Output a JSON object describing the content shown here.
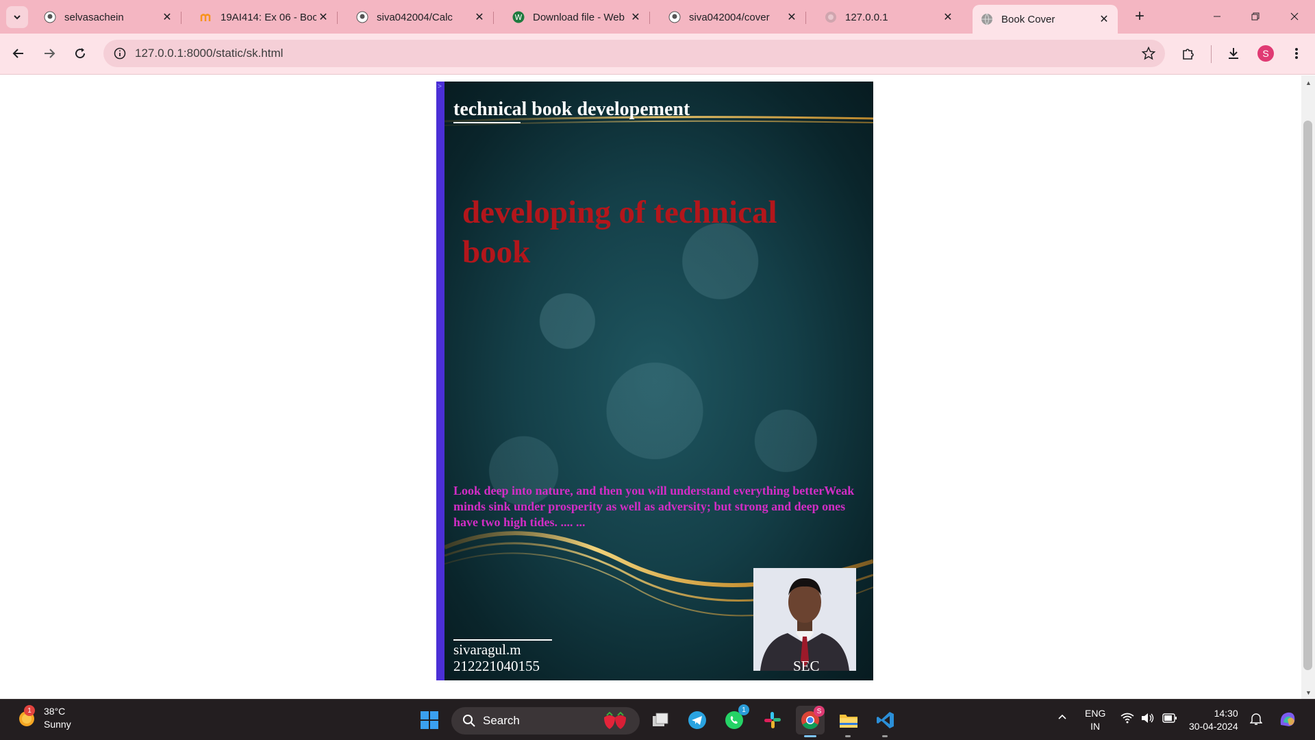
{
  "browser": {
    "tabs": [
      {
        "title": "selvasachein",
        "icon": "github-icon"
      },
      {
        "title": "19AI414: Ex 06 - Boo",
        "icon": "moodle-icon"
      },
      {
        "title": "siva042004/Calc",
        "icon": "github-icon"
      },
      {
        "title": "Download file - Web",
        "icon": "web-icon"
      },
      {
        "title": "siva042004/cover",
        "icon": "github-icon"
      },
      {
        "title": "127.0.0.1",
        "icon": "globe-icon"
      },
      {
        "title": "Book Cover",
        "icon": "globe-icon",
        "active": true
      }
    ],
    "url": "127.0.0.1:8000/static/sk.html",
    "profile_initial": "S"
  },
  "cover": {
    "spine_mark": ">",
    "header": "technical book developement",
    "title": "developing of technical book",
    "quote": "Look deep into nature, and then you will understand everything betterWeak minds sink under prosperity as well as adversity; but strong and deep ones have two high tides. .... ...",
    "author_name": "sivaragul.m",
    "author_id": "212221040155",
    "college": "SEC",
    "colors": {
      "spine": "#4b2fd6",
      "title": "#b3161b",
      "quote": "#d22dc5",
      "header": "#ffffff"
    }
  },
  "taskbar": {
    "weather": {
      "temp": "38°C",
      "condition": "Sunny",
      "badge": "1"
    },
    "search_label": "Search",
    "whatsapp_badge": "1",
    "chrome_badge": "S",
    "lang_top": "ENG",
    "lang_bottom": "IN",
    "time": "14:30",
    "date": "30-04-2024"
  }
}
